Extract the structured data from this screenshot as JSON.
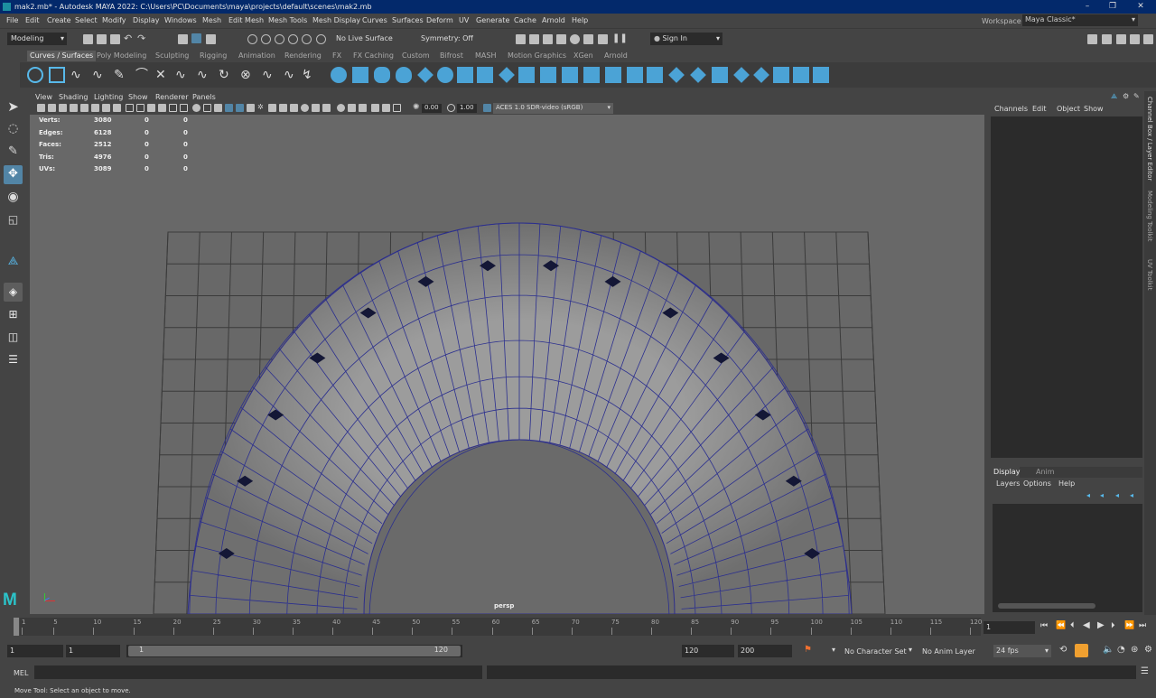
{
  "window": {
    "title": "mak2.mb* - Autodesk MAYA 2022: C:\\Users\\PC\\Documents\\maya\\projects\\default\\scenes\\mak2.mb"
  },
  "menu": [
    "File",
    "Edit",
    "Create",
    "Select",
    "Modify",
    "Display",
    "Windows",
    "Mesh",
    "Edit Mesh",
    "Mesh Tools",
    "Mesh Display",
    "Curves",
    "Surfaces",
    "Deform",
    "UV",
    "Generate",
    "Cache",
    "Arnold",
    "Help"
  ],
  "workspace": {
    "label": "Workspace :",
    "value": "Maya Classic*"
  },
  "status": {
    "mode": "Modeling",
    "live_surface": "No Live Surface",
    "symmetry": "Symmetry: Off",
    "sign_in": "Sign In"
  },
  "shelf_tabs": [
    "Curves / Surfaces",
    "Poly Modeling",
    "Sculpting",
    "Rigging",
    "Animation",
    "Rendering",
    "FX",
    "FX Caching",
    "Custom",
    "Bifrost",
    "MASH",
    "Motion Graphics",
    "XGen",
    "Arnold"
  ],
  "viewport": {
    "menu": [
      "View",
      "Shading",
      "Lighting",
      "Show",
      "Renderer",
      "Panels"
    ],
    "exposure": "0.00",
    "gamma": "1.00",
    "colorspace": "ACES 1.0 SDR-video (sRGB)",
    "camera": "persp",
    "hud": [
      {
        "label": "Verts:",
        "a": "3080",
        "b": "0",
        "c": "0"
      },
      {
        "label": "Edges:",
        "a": "6128",
        "b": "0",
        "c": "0"
      },
      {
        "label": "Faces:",
        "a": "2512",
        "b": "0",
        "c": "0"
      },
      {
        "label": "Tris:",
        "a": "4976",
        "b": "0",
        "c": "0"
      },
      {
        "label": "UVs:",
        "a": "3089",
        "b": "0",
        "c": "0"
      }
    ]
  },
  "channel_box": {
    "menu": [
      "Channels",
      "Edit",
      "Object",
      "Show"
    ]
  },
  "layer_editor": {
    "tabs": [
      "Display",
      "Anim"
    ],
    "menu": [
      "Layers",
      "Options",
      "Help"
    ]
  },
  "side_tabs": [
    "Channel Box / Layer Editor",
    "Modeling Toolkit",
    "UV Toolkit"
  ],
  "timeline": {
    "ticks": [
      "1",
      "5",
      "10",
      "15",
      "20",
      "25",
      "30",
      "35",
      "40",
      "45",
      "50",
      "55",
      "60",
      "65",
      "70",
      "75",
      "80",
      "85",
      "90",
      "95",
      "100",
      "105",
      "110",
      "115",
      "120"
    ],
    "current": "1"
  },
  "range": {
    "start": "1",
    "anim_start": "1",
    "slider_start": "1",
    "slider_end": "120",
    "end": "120",
    "anim_end": "200",
    "character_set": "No Character Set",
    "anim_layer": "No Anim Layer",
    "fps": "24 fps"
  },
  "command": {
    "label": "MEL"
  },
  "help": "Move Tool: Select an object to move."
}
